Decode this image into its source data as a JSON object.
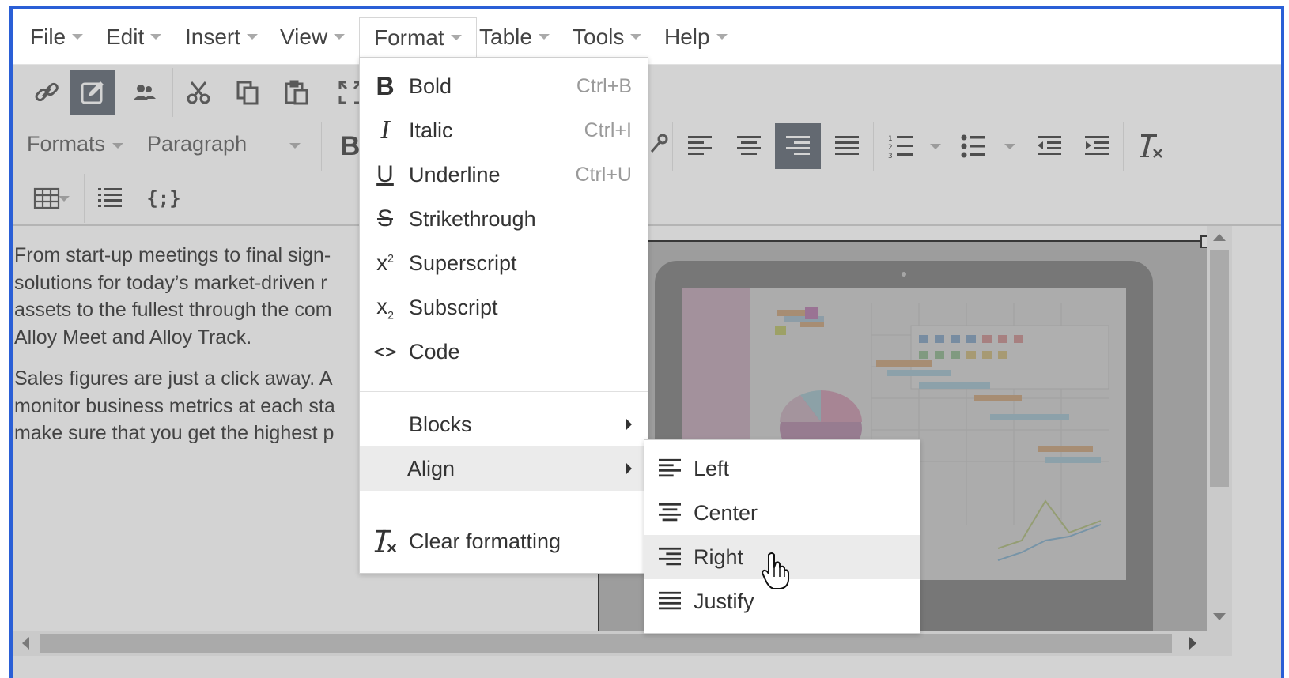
{
  "menubar": {
    "items": [
      {
        "label": "File"
      },
      {
        "label": "Edit"
      },
      {
        "label": "Insert"
      },
      {
        "label": "View"
      },
      {
        "label": "Format"
      },
      {
        "label": "Table"
      },
      {
        "label": "Tools"
      },
      {
        "label": "Help"
      }
    ],
    "active": "Format"
  },
  "toolbar": {
    "formats_label": "Formats",
    "block_format_value": "Paragraph",
    "bold_glyph": "B",
    "codesample_glyph": "{;}",
    "icons": [
      "link-icon",
      "edit-icon",
      "users-icon",
      "cut-icon",
      "copy-icon",
      "paste-icon",
      "fullscreen-icon",
      "align-left-icon",
      "align-center-icon",
      "align-right-icon",
      "align-justify-icon",
      "numbered-list-icon",
      "bullet-list-icon",
      "outdent-icon",
      "indent-icon",
      "clear-formatting-icon",
      "table-icon",
      "list-icon",
      "code-sample-icon"
    ],
    "pressed": [
      "edit-icon",
      "align-right-icon"
    ]
  },
  "content": {
    "paragraph1": [
      "From start-up meetings to final sign-",
      "solutions for today’s market-driven r",
      "assets to the fullest through the com",
      "Alloy Meet and Alloy Track."
    ],
    "paragraph2": [
      "Sales figures are just a click away. A",
      "monitor business metrics at each sta",
      "make sure that you get the highest p"
    ]
  },
  "format_menu": {
    "items": [
      {
        "label": "Bold",
        "shortcut": "Ctrl+B",
        "icon": "bold-icon"
      },
      {
        "label": "Italic",
        "shortcut": "Ctrl+I",
        "icon": "italic-icon"
      },
      {
        "label": "Underline",
        "shortcut": "Ctrl+U",
        "icon": "underline-icon"
      },
      {
        "label": "Strikethrough",
        "shortcut": "",
        "icon": "strikethrough-icon"
      },
      {
        "label": "Superscript",
        "shortcut": "",
        "icon": "superscript-icon"
      },
      {
        "label": "Subscript",
        "shortcut": "",
        "icon": "subscript-icon"
      },
      {
        "label": "Code",
        "shortcut": "",
        "icon": "code-icon"
      }
    ],
    "submenus": [
      {
        "label": "Blocks"
      },
      {
        "label": "Align",
        "highlighted": true
      }
    ],
    "clear_label": "Clear formatting"
  },
  "align_menu": {
    "items": [
      {
        "label": "Left",
        "icon": "align-left-icon"
      },
      {
        "label": "Center",
        "icon": "align-center-icon"
      },
      {
        "label": "Right",
        "icon": "align-right-icon",
        "highlighted": true
      },
      {
        "label": "Justify",
        "icon": "align-justify-icon"
      }
    ]
  },
  "colors": {
    "frame_border": "#2a5fd6",
    "pressed_button": "#545d69",
    "menu_highlight": "#ebebeb"
  }
}
